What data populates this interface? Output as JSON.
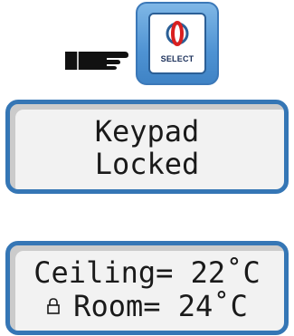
{
  "select_button": {
    "label": "SELECT",
    "icon": "globe-ring-icon",
    "accent_color": "#4f93d3"
  },
  "pointer": {
    "icon": "pointing-hand-icon"
  },
  "display_top": {
    "line1": "Keypad",
    "line2": "Locked"
  },
  "display_bottom": {
    "line1": "Ceiling= 22˚C",
    "lock_icon": "lock-icon",
    "line2": "Room= 24˚C"
  }
}
